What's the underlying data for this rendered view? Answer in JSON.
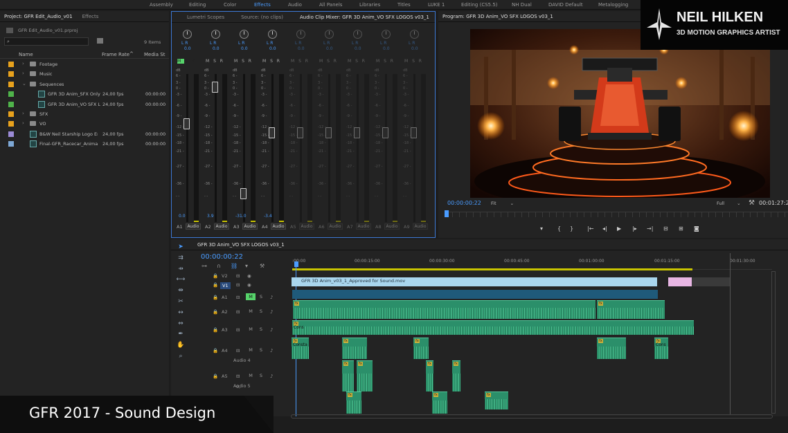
{
  "workspaces": [
    "Assembly",
    "Editing",
    "Color",
    "Effects",
    "Audio",
    "All Panels",
    "Libraries",
    "Titles",
    "LUKE 1",
    "Editing (CS5.5)",
    "NH Dual",
    "DAVID Default",
    "Metalogging"
  ],
  "active_workspace": "Effects",
  "project": {
    "tab_label": "Project: GFR Edit_Audio_v01",
    "effects_tab": "Effects",
    "file": "GFR Edit_Audio_v01.prproj",
    "count": "9 Items",
    "columns": {
      "name": "Name",
      "frame_rate": "Frame Rate",
      "media": "Media St"
    },
    "items": [
      {
        "name": "Footage",
        "fps": "",
        "ms": "",
        "color": "#e8a21d",
        "type": "bin",
        "indent": 0
      },
      {
        "name": "Music",
        "fps": "",
        "ms": "",
        "color": "#e8a21d",
        "type": "bin",
        "indent": 0
      },
      {
        "name": "Sequences",
        "fps": "",
        "ms": "",
        "color": "#e8a21d",
        "type": "bin-open",
        "indent": 0
      },
      {
        "name": "GFR 3D Anim_SFX Only",
        "fps": "24,00 fps",
        "ms": "00:00:00",
        "color": "#4fb34a",
        "type": "seq",
        "indent": 1
      },
      {
        "name": "GFR 3D Anim_VO SFX L",
        "fps": "24,00 fps",
        "ms": "00:00:00",
        "color": "#4fb34a",
        "type": "seq",
        "indent": 1
      },
      {
        "name": "SFX",
        "fps": "",
        "ms": "",
        "color": "#e8a21d",
        "type": "bin",
        "indent": 0
      },
      {
        "name": "VO",
        "fps": "",
        "ms": "",
        "color": "#e8a21d",
        "type": "bin",
        "indent": 0
      },
      {
        "name": "B&W Neil Starship Logo En",
        "fps": "24,00 fps",
        "ms": "00:00:00",
        "color": "#9b8bd6",
        "type": "clip",
        "indent": 0
      },
      {
        "name": "Final-GFR_Racecar_Animati",
        "fps": "24,00 fps",
        "ms": "00:00:00",
        "color": "#7ea8d6",
        "type": "clip",
        "indent": 0
      }
    ]
  },
  "mixer": {
    "tabs": [
      "Lumetri Scopes",
      "Source: (no clips)",
      "Audio Clip Mixer: GFR 3D Anim_VO SFX LOGOS v03_1"
    ],
    "db_scale": [
      "dB",
      "6 -",
      "3 -",
      "0 -",
      "-3 -",
      "-6 -",
      "-9 -",
      "-12 -",
      "-15 -",
      "-18 -",
      "-21 -",
      "-27 -",
      "-36 -",
      "- -"
    ],
    "channels": [
      {
        "name": "A1",
        "pan": "0.0",
        "vol": "0.0",
        "fader": 0.3,
        "active": true
      },
      {
        "name": "A2",
        "pan": "0.0",
        "vol": "3.9",
        "fader": 0.05,
        "active": true
      },
      {
        "name": "A3",
        "pan": "0.0",
        "vol": "-31.0",
        "fader": 0.77,
        "active": true
      },
      {
        "name": "A4",
        "pan": "0.0",
        "vol": "-3.4",
        "fader": 0.36,
        "active": true
      },
      {
        "name": "A5",
        "pan": "0.0",
        "vol": "",
        "fader": 0.36,
        "active": false
      },
      {
        "name": "A6",
        "pan": "0.0",
        "vol": "",
        "fader": 0.36,
        "active": false
      },
      {
        "name": "A7",
        "pan": "0.0",
        "vol": "",
        "fader": 0.36,
        "active": false
      },
      {
        "name": "A8",
        "pan": "0.0",
        "vol": "",
        "fader": 0.36,
        "active": false
      },
      {
        "name": "A9",
        "pan": "0.0",
        "vol": "",
        "fader": 0.36,
        "active": false
      }
    ],
    "audio_label": "Audio",
    "lr": "L  R",
    "msr": "M S R"
  },
  "program": {
    "title": "Program: GFR 3D Anim_VO SFX LOGOS v03_1",
    "timecode": "00:00:00:22",
    "fit": "Fit",
    "quality": "Full",
    "duration": "00:01:27:2"
  },
  "timeline": {
    "tab": "GFR 3D Anim_VO SFX LOGOS v03_1",
    "timecode": "00:00:00:22",
    "ruler": [
      ":00:00",
      "00:00:15:00",
      "00:00:30:00",
      "00:00:45:00",
      "00:01:00:00",
      "00:01:15:00",
      "00:01:30:00"
    ],
    "tracks": [
      {
        "name": "V2",
        "sub": ""
      },
      {
        "name": "V1",
        "sub": ""
      },
      {
        "name": "A1",
        "sub": ""
      },
      {
        "name": "A2",
        "sub": ""
      },
      {
        "name": "A3",
        "sub": ""
      },
      {
        "name": "A4",
        "sub": "Audio 4"
      },
      {
        "name": "A5",
        "sub": "Audio 5"
      },
      {
        "name": "",
        "sub": ""
      }
    ],
    "video_clip": "GFR 3D Anim_v03_1_Approved for Sound.mov",
    "clip_labels": {
      "cons": "Cons",
      "constant": "Consta",
      "fx": "fx"
    },
    "a5_value": "0,"
  },
  "branding": {
    "name": "NEIL HILKEN",
    "tagline": "3D MOTION GRAPHICS ARTIST",
    "caption": "GFR 2017 - Sound Design"
  }
}
